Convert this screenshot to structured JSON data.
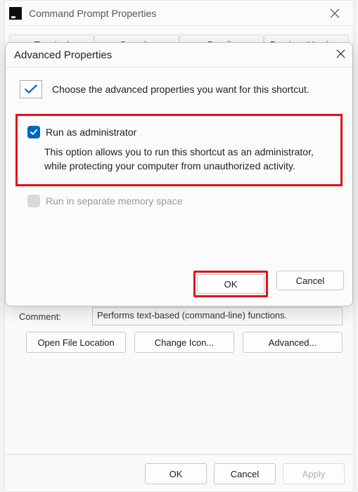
{
  "parent_window": {
    "title": "Command Prompt Properties",
    "tabs": [
      "Terminal",
      "Security",
      "Details",
      "Previous Versions"
    ],
    "comment": {
      "label": "Comment:",
      "value": "Performs text-based (command-line) functions."
    },
    "action_buttons": {
      "open_file_location": "Open File Location",
      "change_icon": "Change Icon...",
      "advanced": "Advanced..."
    },
    "footer": {
      "ok": "OK",
      "cancel": "Cancel",
      "apply": "Apply"
    }
  },
  "modal": {
    "title": "Advanced Properties",
    "heading": "Choose the advanced properties you want for this shortcut.",
    "run_as_admin": {
      "label": "Run as administrator",
      "description": "This option allows you to run this shortcut as an administrator, while protecting your computer from unauthorized activity."
    },
    "separate_memory": {
      "label": "Run in separate memory space"
    },
    "buttons": {
      "ok": "OK",
      "cancel": "Cancel"
    }
  }
}
